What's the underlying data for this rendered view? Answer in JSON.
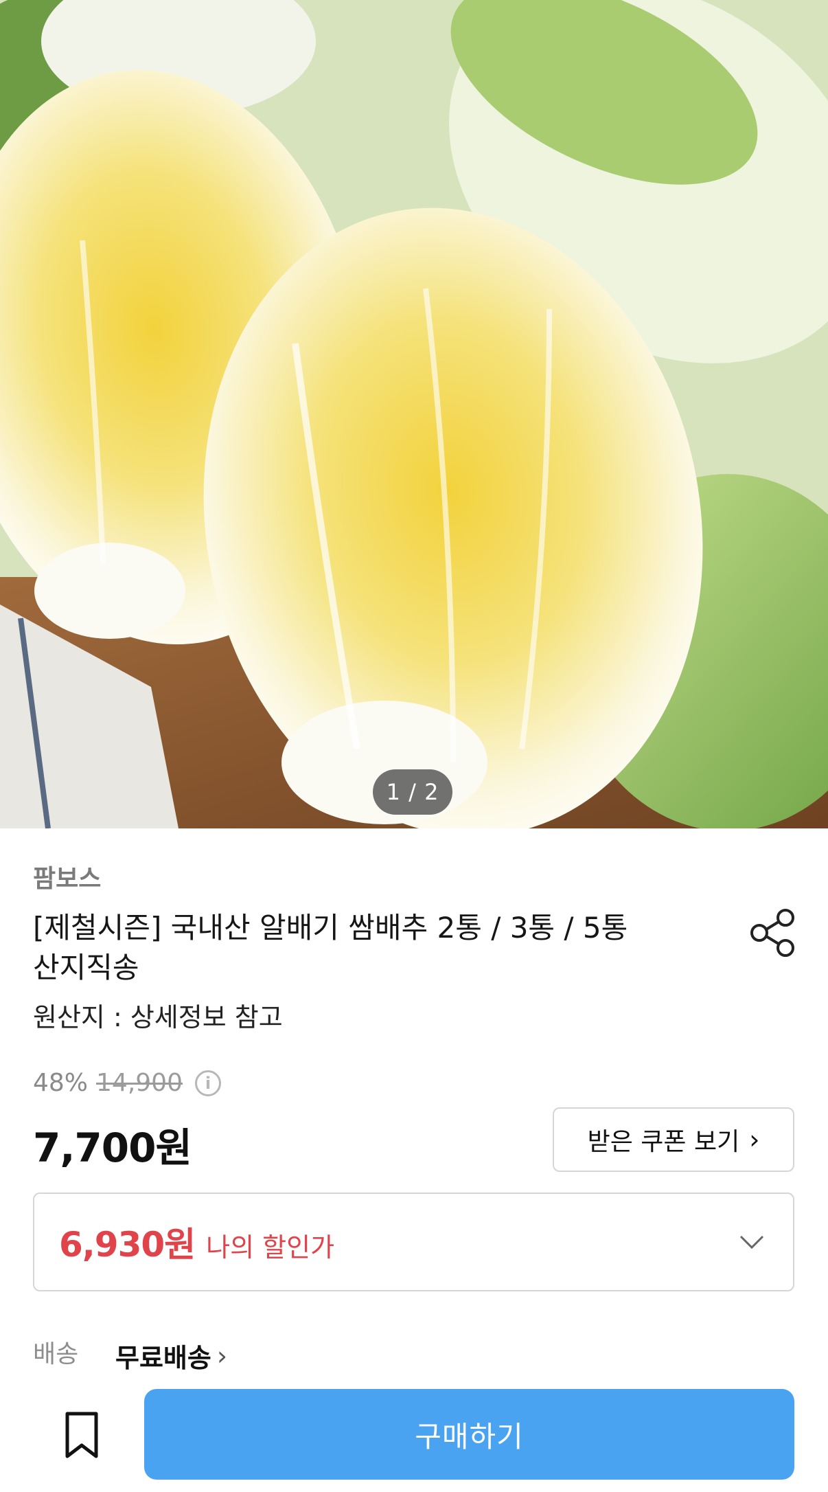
{
  "gallery": {
    "current_page": "1",
    "total_pages": "2",
    "pager_text": "1 / 2"
  },
  "product": {
    "seller": "팜보스",
    "title": "[제철시즌] 국내산 알배기 쌈배추 2통 / 3통 / 5통 산지직송",
    "origin": "원산지 : 상세정보 참고"
  },
  "pricing": {
    "discount_rate": "48%",
    "original_price": "14,900",
    "sale_price": "7,700원",
    "coupon_button": "받은 쿠폰 보기",
    "my_price": "6,930원",
    "my_price_label": "나의 할인가"
  },
  "shipping": {
    "label": "배송",
    "value": "무료배송"
  },
  "bottom_bar": {
    "buy_button": "구매하기"
  },
  "icons": {
    "share": "share-icon",
    "info": "info-icon",
    "chevron_right": "chevron-right-icon",
    "chevron_down": "chevron-down-icon",
    "bookmark": "bookmark-icon"
  },
  "colors": {
    "accent_blue": "#4aa3f0",
    "discount_red": "#e0434a",
    "muted_gray": "#8a8a8a"
  }
}
